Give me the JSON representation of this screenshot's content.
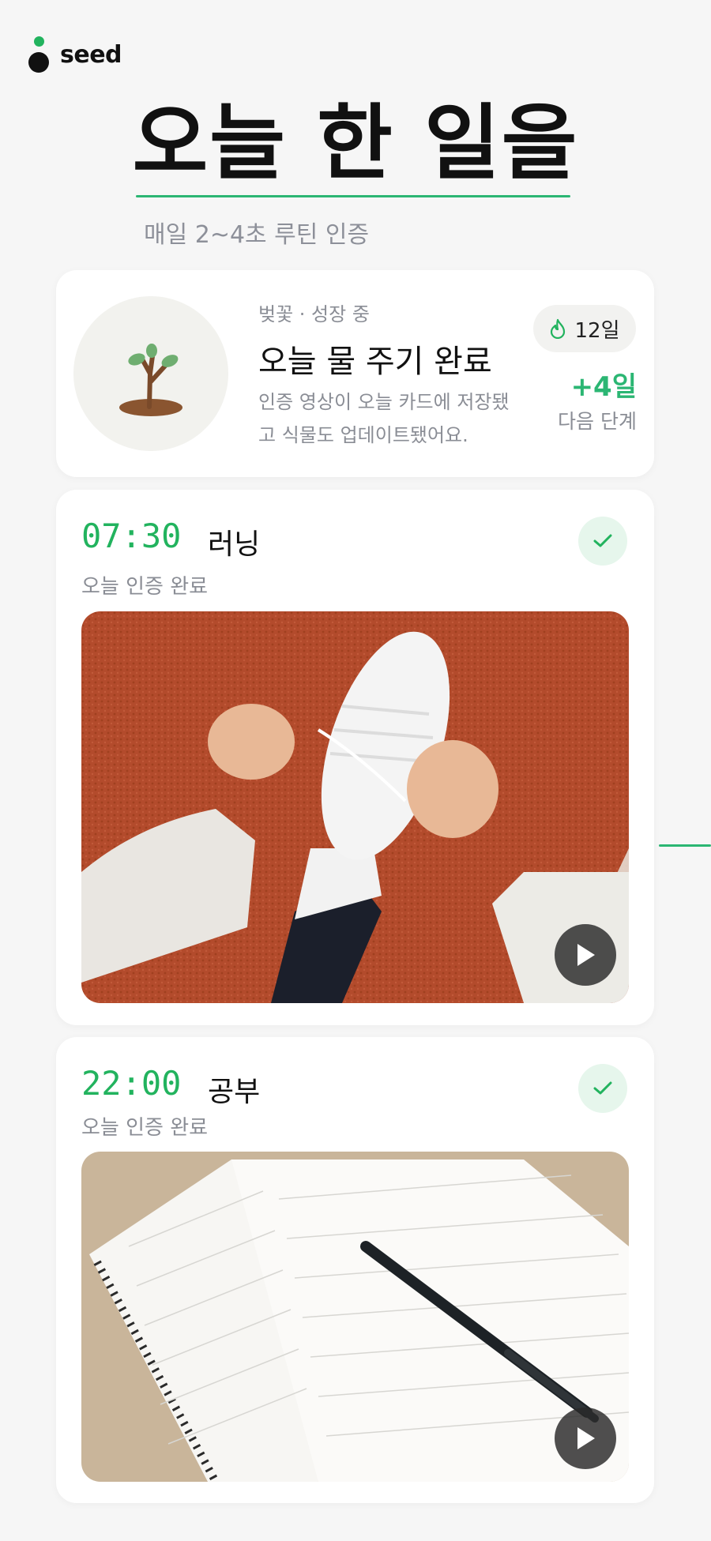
{
  "app": {
    "logo_text": "seed"
  },
  "hero": {
    "title": "오늘 한 일을",
    "subtitle": "매일 2~4초 루틴 인증"
  },
  "plant": {
    "stage": "벚꽃 · 성장 중",
    "title": "오늘 물 주기 완료",
    "description": "인증 영상이 오늘 카드에 저장됐고 식물도 업데이트됐어요.",
    "streak": "12일",
    "next_days": "+4일",
    "next_label": "다음 단계"
  },
  "routines": [
    {
      "time": "07:30",
      "name": "러닝",
      "status": "오늘 인증 완료",
      "media": "running-shoe-photo"
    },
    {
      "time": "22:00",
      "name": "공부",
      "status": "오늘 인증 완료",
      "media": "notebook-photo"
    }
  ],
  "colors": {
    "accent": "#22b35e",
    "check_bg": "#e6f6ec",
    "background": "#f6f6f6",
    "muted": "#8a8d95"
  },
  "icons": [
    "seed-logo-icon",
    "flame-icon",
    "check-icon",
    "play-icon",
    "sprout-icon"
  ]
}
